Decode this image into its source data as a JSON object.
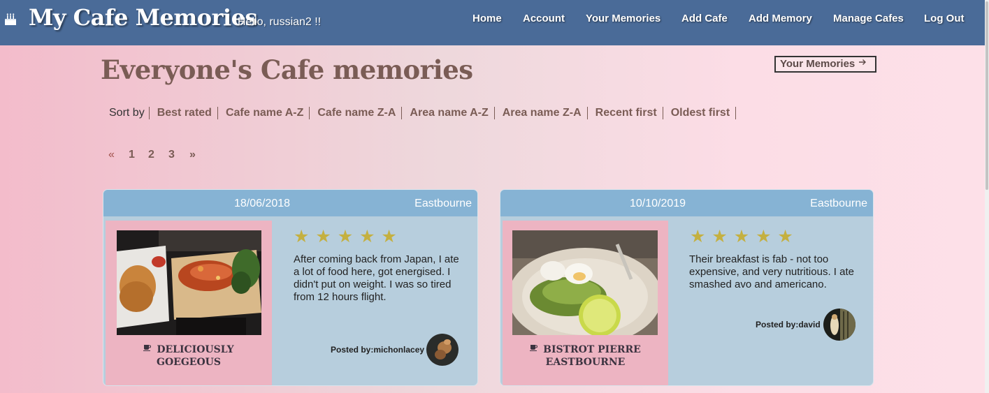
{
  "brand": {
    "title": "My Cafe Memories",
    "greeting": "Hello, russian2 !!",
    "icon": "cake-icon"
  },
  "nav": [
    "Home",
    "Account",
    "Your Memories",
    "Add Cafe",
    "Add Memory",
    "Manage Cafes",
    "Log Out"
  ],
  "page": {
    "title": "Everyone's Cafe memories",
    "your_memories_link": "Your Memories",
    "link_icon": "arrow-right-icon"
  },
  "sort": {
    "label": "Sort by",
    "options": [
      "Best rated",
      "Cafe name A-Z",
      "Cafe name Z-A",
      "Area name A-Z",
      "Area name Z-A",
      "Recent first",
      "Oldest first"
    ]
  },
  "pagination": {
    "prev": "«",
    "pages": [
      "1",
      "2",
      "3"
    ],
    "next": "»"
  },
  "memories": [
    {
      "date": "18/06/2018",
      "area": "Eastbourne",
      "rating": 5,
      "stars": "★ ★ ★ ★ ★",
      "cafe": [
        "DELICIOUSLY",
        "GOEGEOUS"
      ],
      "cafe_icon": "coffee-cup-icon",
      "review": "After coming back from Japan, I ate a lot of food here, got energised. I didn't put on weight. I was so tired from 12 hours flight.",
      "posted_by": "Posted by:michonlacey"
    },
    {
      "date": "10/10/2019",
      "area": "Eastbourne",
      "rating": 5,
      "stars": "★ ★ ★ ★ ★",
      "cafe": [
        "BISTROT PIERRE",
        "EASTBOURNE"
      ],
      "cafe_icon": "coffee-cup-icon",
      "review": "Their breakfast is fab - not too expensive, and very nutritious. I ate smashed avo and americano.",
      "posted_by": "Posted by:david"
    }
  ],
  "colors": {
    "header": "#4a6b98",
    "card": "#b7cedd",
    "card_header": "#86b3d4",
    "card_left": "#edb4c2",
    "star": "#c4b040",
    "accent_text": "#7a5c55"
  }
}
